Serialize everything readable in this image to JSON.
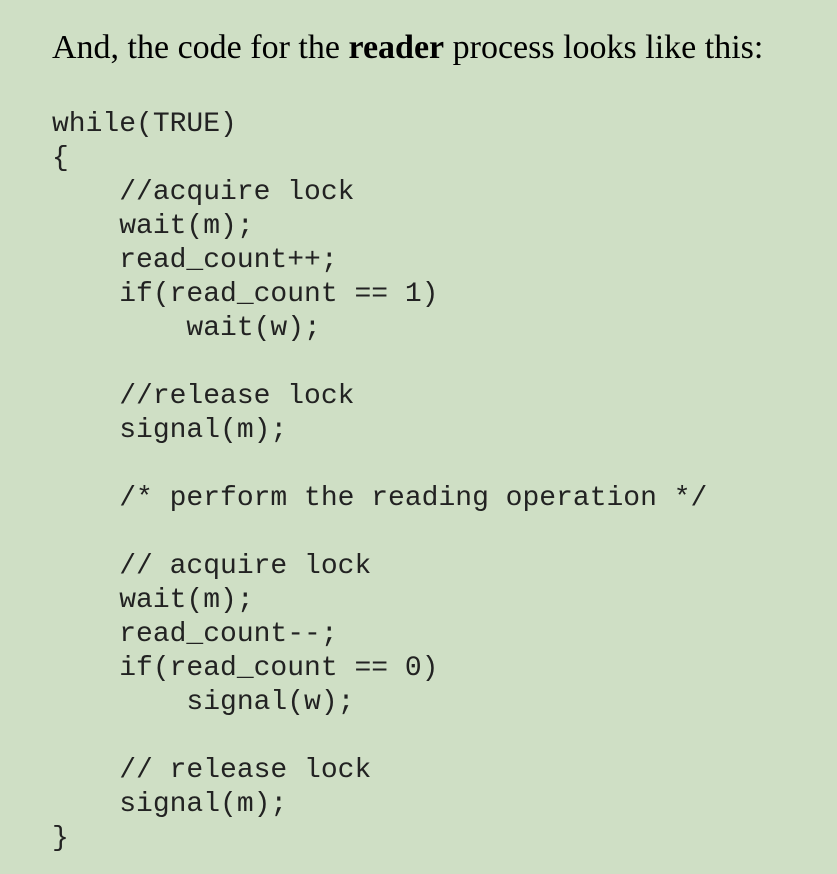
{
  "intro": {
    "before": "And, the code for the ",
    "bold": "reader",
    "after": " process looks like this:"
  },
  "code": {
    "lines": [
      "while(TRUE)",
      "{",
      "    //acquire lock",
      "    wait(m);",
      "    read_count++;",
      "    if(read_count == 1)",
      "        wait(w);",
      "",
      "    //release lock",
      "    signal(m);",
      "",
      "    /* perform the reading operation */",
      "",
      "    // acquire lock",
      "    wait(m);",
      "    read_count--;",
      "    if(read_count == 0)",
      "        signal(w);",
      "",
      "    // release lock",
      "    signal(m);",
      "}"
    ]
  }
}
